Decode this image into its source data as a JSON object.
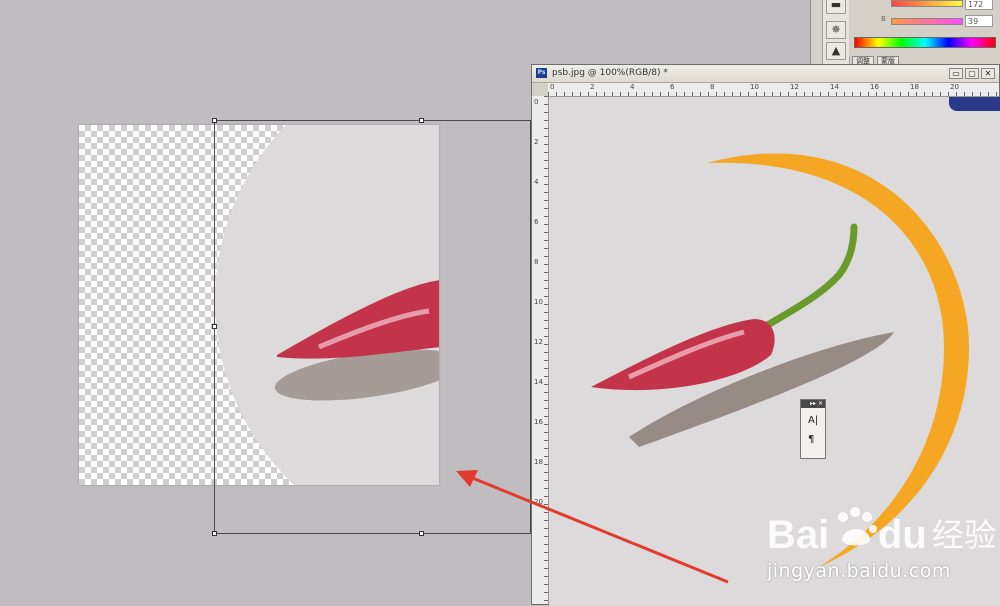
{
  "document": {
    "title": "psb.jpg @ 100%(RGB/8) *",
    "app_badge": "Ps",
    "ruler_top_numbers": [
      "0",
      "2",
      "4",
      "6",
      "8",
      "10",
      "12",
      "14",
      "16",
      "18",
      "20"
    ],
    "ruler_left_numbers": [
      "0",
      "2",
      "4",
      "6",
      "8",
      "10",
      "12",
      "14",
      "16",
      "18",
      "20"
    ],
    "window_buttons": [
      "▭",
      "▢",
      "✕"
    ]
  },
  "color_panel": {
    "value_top": "172",
    "slider_b_label": "B",
    "value_b": "39",
    "tabs": [
      "调整",
      "蒙版"
    ]
  },
  "tool_column": {
    "icons": [
      "swatch-icon",
      "compass-icon",
      "image-icon"
    ]
  },
  "char_panel": {
    "header": "▸▸ ✕",
    "tools": [
      "A|",
      "¶"
    ]
  },
  "watermark": {
    "brand_left": "Bai",
    "brand_right": "经验",
    "url": "jingyan.baidu.com"
  },
  "colors": {
    "background": "#c0bdc1",
    "crescent": "#f5a623",
    "arrow": "#e23a2e",
    "pepper_red": "#c3344a",
    "stem_green": "#6a9a2a"
  }
}
